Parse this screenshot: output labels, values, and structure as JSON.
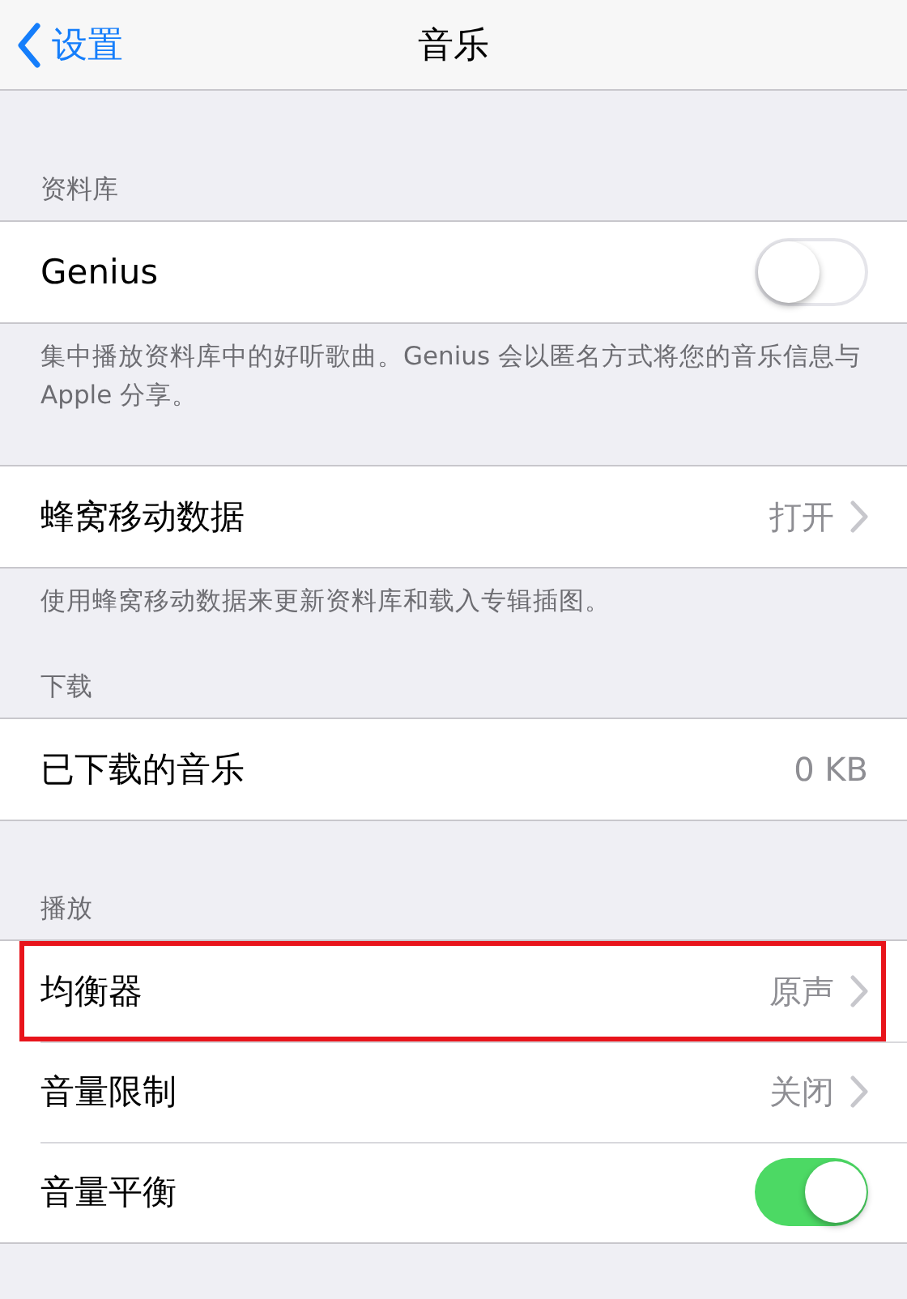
{
  "nav": {
    "back": "设置",
    "title": "音乐"
  },
  "sections": [
    {
      "header": "资料库",
      "rows": [
        {
          "kind": "switch",
          "label": "Genius",
          "on": false,
          "highlighted": false
        }
      ],
      "footer": "集中播放资料库中的好听歌曲。Genius 会以匿名方式将您的音乐信息与 Apple 分享。"
    },
    {
      "rows": [
        {
          "kind": "disclosure",
          "label": "蜂窝移动数据",
          "value": "打开",
          "highlighted": false
        }
      ],
      "footer": "使用蜂窝移动数据来更新资料库和载入专辑插图。"
    },
    {
      "header": "下载",
      "rows": [
        {
          "kind": "value",
          "label": "已下载的音乐",
          "value": "0 KB",
          "highlighted": false
        }
      ]
    },
    {
      "header": "播放",
      "rows": [
        {
          "kind": "disclosure",
          "label": "均衡器",
          "value": "原声",
          "highlighted": true
        },
        {
          "kind": "disclosure",
          "label": "音量限制",
          "value": "关闭",
          "highlighted": false
        },
        {
          "kind": "switch",
          "label": "音量平衡",
          "on": true,
          "highlighted": false
        }
      ]
    }
  ]
}
